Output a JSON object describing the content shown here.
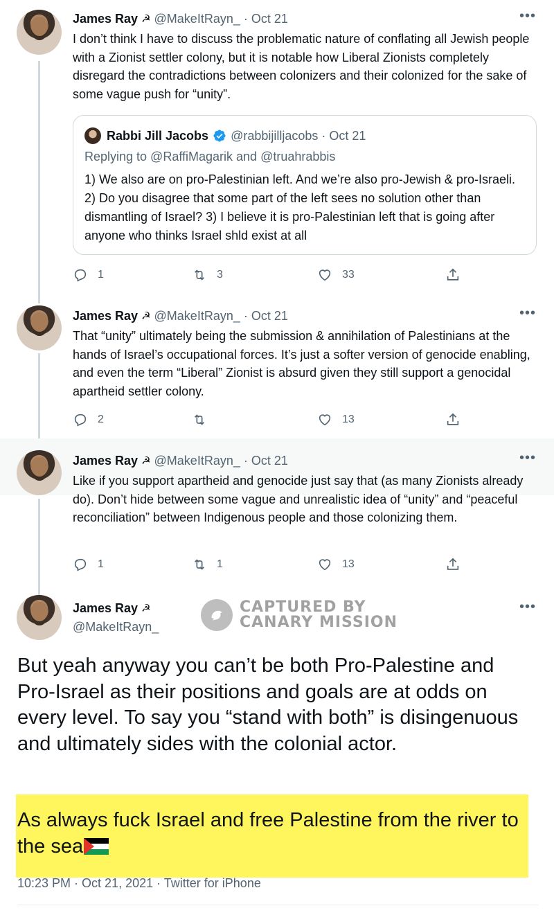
{
  "tweets": [
    {
      "name": "James Ray",
      "handle": "@MakeItRayn_",
      "date": "· Oct 21",
      "text": "I don’t think I have to discuss the problematic nature of conflating all Jewish people with a Zionist settler colony, but it is notable how Liberal Zionists completely disregard the contradictions between colonizers and their colonized for the sake of some vague push for “unity”.",
      "quote": {
        "name": "Rabbi Jill Jacobs",
        "handle": "@rabbijilljacobs",
        "date": "· Oct 21",
        "replying": "Replying to @RaffiMagarik and @truahrabbis",
        "text": "1) We also are on pro-Palestinian left. And we’re also pro-Jewish & pro-Israeli. 2) Do you disagree that some part of the left sees no solution other than dismantling of Israel? 3) I believe it is pro-Palestinian left that is going after anyone who thinks Israel shld exist at all"
      },
      "replies": "1",
      "retweets": "3",
      "likes": "33"
    },
    {
      "name": "James Ray",
      "handle": "@MakeItRayn_",
      "date": "· Oct 21",
      "text": "That “unity” ultimately being the submission & annihilation of Palestinians at the hands of Israel’s occupational forces. It’s just a softer version of genocide enabling, and even the term “Liberal” Zionist is absurd given they still support a genocidal apartheid settler colony.",
      "replies": "2",
      "retweets": "",
      "likes": "13"
    },
    {
      "name": "James Ray",
      "handle": "@MakeItRayn_",
      "date": "· Oct 21",
      "text": "Like if you support apartheid and genocide just say that (as many Zionists already do). Don’t hide between some vague and unrealistic idea of “unity” and “peaceful reconciliation” between Indigenous people and those colonizing them.",
      "replies": "1",
      "retweets": "1",
      "likes": "13"
    }
  ],
  "main": {
    "name": "James Ray",
    "handle": "@MakeItRayn_",
    "text": "But yeah anyway you can’t be both Pro-Palestine and Pro-Israel as their positions and goals are at odds on every level. To say you “stand with both” is disingenuous and ultimately sides with the colonial actor.",
    "highlight_text": "As always fuck Israel and free Palestine from the river to the sea",
    "footer": "10:23 PM · Oct 21, 2021 · Twitter for iPhone"
  },
  "watermark": {
    "line1": "CAPTURED BY",
    "line2": "CANARY MISSION"
  },
  "icons": {
    "more": "more-horizontal-icon",
    "name_emoji": "☭",
    "verified_color": "#1d9bf0"
  },
  "colors": {
    "highlight": "#fff55c",
    "muted": "#536471"
  }
}
